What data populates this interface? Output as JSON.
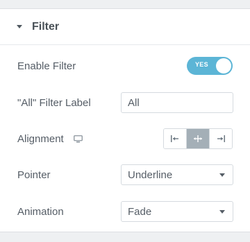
{
  "section": {
    "title": "Filter",
    "expanded": true
  },
  "controls": {
    "enable_filter": {
      "label": "Enable Filter",
      "toggle_text": "YES",
      "on": true,
      "color": "#5cb5d6"
    },
    "filter_label": {
      "label": "\"All\" Filter Label",
      "value": "All"
    },
    "alignment": {
      "label": "Alignment",
      "responsive_icon": "desktop-monitor-icon",
      "options": [
        "align-left-icon",
        "align-center-icon",
        "align-right-icon"
      ],
      "selected": "align-center-icon"
    },
    "pointer": {
      "label": "Pointer",
      "value": "Underline"
    },
    "animation": {
      "label": "Animation",
      "value": "Fade"
    }
  }
}
